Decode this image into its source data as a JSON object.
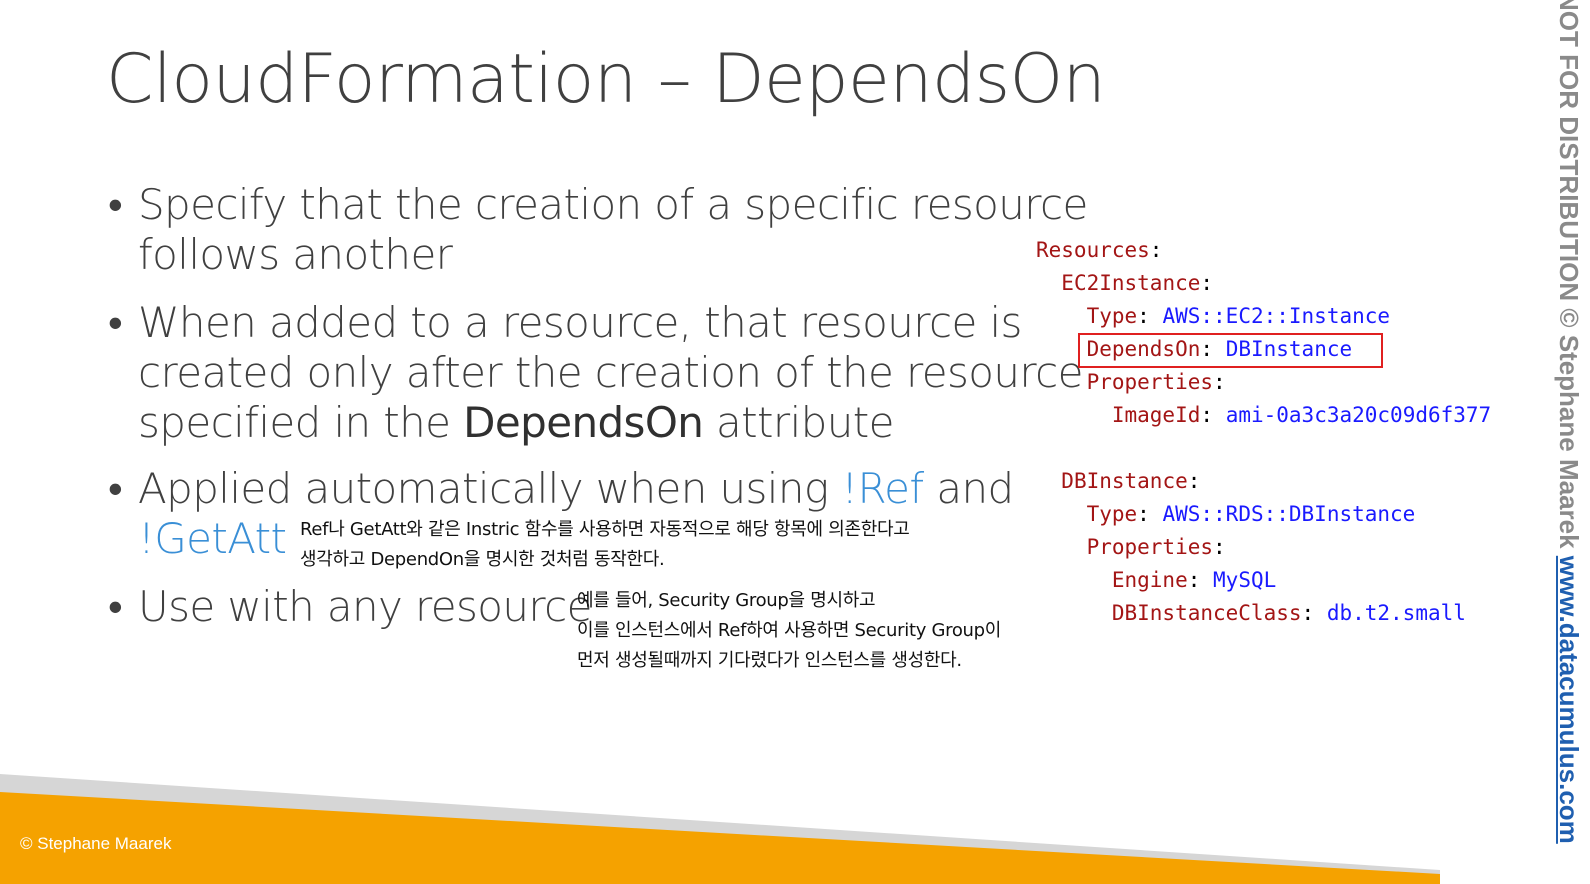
{
  "title": "CloudFormation – DependsOn",
  "bullets": {
    "b1_line1": "Specify that the creation of a specific resource",
    "b1_line2": "follows another",
    "b2_line1": "When added to a resource, that resource is",
    "b2_line2": "created only after the creation of the resource",
    "b2_line3_pre": "specified in the ",
    "b2_line3_keyword": "DependsOn",
    "b2_line3_post": " attribute",
    "b3_line1_pre": "Applied automatically when using ",
    "b3_ref": "!Ref",
    "b3_and": " and",
    "b3_getatt": "!GetAtt",
    "b4": "Use with any resource",
    "bullet_symbol": "•"
  },
  "notes": {
    "note1_line1": "Ref나 GetAtt와 같은 Instric 함수를 사용하면 자동적으로 해당 항목에 의존한다고",
    "note1_line2": "생각하고 DependOn을 명시한 것처럼 동작한다.",
    "note2_line1": "예를 들어, Security Group을 명시하고",
    "note2_line2": "이를 인스턴스에서 Ref하여 사용하면 Security Group이",
    "note2_line3": "먼저 생성될때까지 기다렸다가 인스턴스를 생성한다."
  },
  "code": {
    "resources": "Resources",
    "ec2_name": "EC2Instance",
    "type_key": "Type",
    "ec2_type": "AWS::EC2::Instance",
    "depends_key": "DependsOn",
    "depends_val": "DBInstance",
    "props_key": "Properties",
    "imageid_key": "ImageId",
    "imageid_val": "ami-0a3c3a20c09d6f377",
    "db_name": "DBInstance",
    "db_type": "AWS::RDS::DBInstance",
    "engine_key": "Engine",
    "engine_val": "MySQL",
    "dbclass_key": "DBInstanceClass",
    "dbclass_val": "db.t2.small",
    "colon": ":"
  },
  "footer": {
    "copyright": "© Stephane Maarek"
  },
  "watermark": {
    "text": "NOT FOR DISTRIBUTION © Stephane Maarek ",
    "url": "www.datacumulus.com"
  },
  "colors": {
    "orange": "#f5a200",
    "grey_band": "#d6d6d6",
    "keyword_blue": "#3a8fd6",
    "highlight_red": "#e02020"
  }
}
